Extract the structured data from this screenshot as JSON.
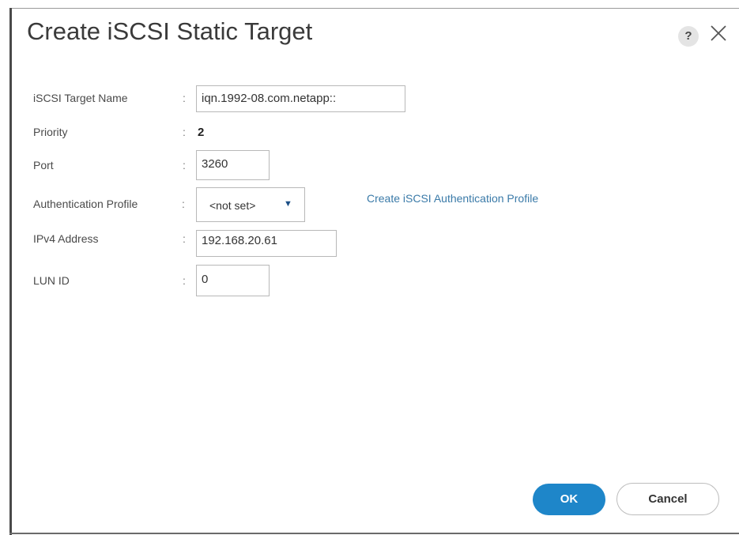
{
  "dialog": {
    "title": "Create iSCSI Static Target",
    "help_label": "?"
  },
  "form": {
    "target_name": {
      "label": "iSCSI Target Name",
      "colon": ":",
      "value": "iqn.1992-08.com.netapp::"
    },
    "priority": {
      "label": "Priority",
      "colon": ":",
      "value": "2"
    },
    "port": {
      "label": "Port",
      "colon": ":",
      "value": "3260"
    },
    "auth_profile": {
      "label": "Authentication Profile",
      "colon": ":",
      "selected": "<not set>",
      "create_link": "Create iSCSI Authentication Profile"
    },
    "ipv4": {
      "label": "IPv4 Address",
      "colon": ":",
      "value": "192.168.20.61"
    },
    "lun_id": {
      "label": "LUN ID",
      "colon": ":",
      "value": "0"
    }
  },
  "buttons": {
    "ok": "OK",
    "cancel": "Cancel"
  },
  "colors": {
    "accent": "#1e86c9",
    "link": "#3a7aa8"
  }
}
